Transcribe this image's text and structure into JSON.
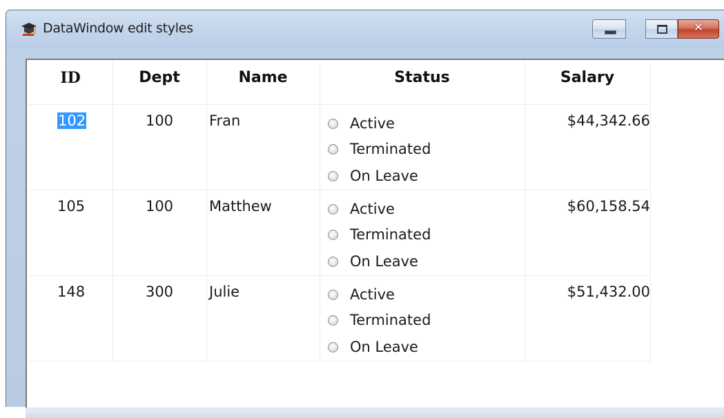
{
  "window": {
    "title": "DataWindow edit styles",
    "app_icon": "graduation-cap-icon",
    "close_glyph": "✕"
  },
  "columns": {
    "id": "ID",
    "dept": "Dept",
    "name": "Name",
    "status": "Status",
    "salary": "Salary"
  },
  "status_options": [
    "Active",
    "Terminated",
    "On Leave"
  ],
  "rows": [
    {
      "id": "102",
      "dept": "100",
      "name": "Fran",
      "salary": "$44,342.66",
      "selected": true
    },
    {
      "id": "105",
      "dept": "100",
      "name": "Matthew",
      "salary": "$60,158.54"
    },
    {
      "id": "148",
      "dept": "300",
      "name": "Julie",
      "salary": "$51,432.00"
    }
  ],
  "colors": {
    "selection": "#3399ff",
    "titlebar": "#c3d5ec",
    "close_button": "#c2432a"
  }
}
